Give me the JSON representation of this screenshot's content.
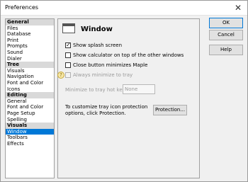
{
  "window": {
    "title": "Preferences",
    "close_glyph": "✕"
  },
  "nav": {
    "groups": [
      {
        "label": "General",
        "items": [
          "Files",
          "Database",
          "Print",
          "Prompts",
          "Sound",
          "Dialer"
        ]
      },
      {
        "label": "Tree",
        "items": [
          "Visuals",
          "Navigation",
          "Font and Color",
          "Icons"
        ]
      },
      {
        "label": "Editing",
        "items": [
          "General",
          "Font and Color",
          "Page Setup",
          "Spelling"
        ]
      },
      {
        "label": "Visuals",
        "items": [
          "Window",
          "Toolbars",
          "Effects"
        ]
      }
    ],
    "selected": "Window"
  },
  "panel": {
    "title": "Window",
    "icon": "window-icon",
    "show_splash_label": "Show splash screen",
    "show_splash_checked": true,
    "show_calc_label": "Show calculator on top of the other windows",
    "show_calc_checked": false,
    "close_min_label": "Close button minimizes Maple",
    "close_min_checked": false,
    "always_tray_label": "Always minimize to tray",
    "always_tray_checked": false,
    "hotkey_label": "Minimize to tray hot key",
    "hotkey_value": "None",
    "protection_text": "To customize tray icon protection options, click Protection.",
    "protection_button": "Protection..."
  },
  "buttons": {
    "ok": "OK",
    "cancel": "Cancel",
    "help": "Help"
  },
  "colors": {
    "selection": "#0078d7",
    "group_bg": "#d9d9d9",
    "dialog_bg": "#f0f0f0"
  }
}
